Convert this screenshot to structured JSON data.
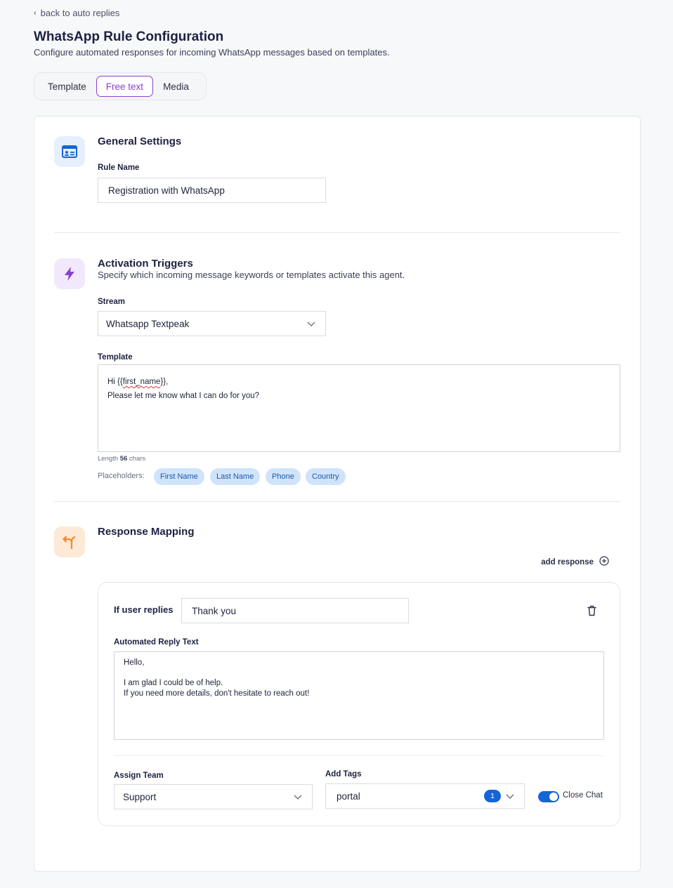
{
  "header": {
    "back_label": "back to auto replies",
    "title": "WhatsApp Rule Configuration",
    "subtitle": "Configure automated responses for incoming WhatsApp messages based on templates."
  },
  "tabs": [
    {
      "label": "Template",
      "active": false
    },
    {
      "label": "Free text",
      "active": true
    },
    {
      "label": "Media",
      "active": false
    }
  ],
  "general": {
    "title": "General Settings",
    "rule_name_label": "Rule Name",
    "rule_name_value": "Registration with WhatsApp"
  },
  "triggers": {
    "title": "Activation Triggers",
    "description": "Specify which incoming message keywords or templates activate this agent.",
    "stream_label": "Stream",
    "stream_value": "Whatsapp Textpeak",
    "template_label": "Template",
    "template_line1_prefix": "Hi {{",
    "template_line1_var": "first_name",
    "template_line1_suffix": "}},",
    "template_line2": "Please let me know what I can do for you?",
    "length_prefix": "Length",
    "length_value": "56",
    "length_suffix": "chars",
    "placeholders_label": "Placeholders:",
    "placeholders": [
      "First Name",
      "Last Name",
      "Phone",
      "Country"
    ]
  },
  "mapping": {
    "title": "Response Mapping",
    "add_response_label": "add response",
    "if_user_replies_label": "If user replies",
    "if_user_replies_value": "Thank you",
    "reply_text_label": "Automated Reply Text",
    "reply_text_value": "Hello,\n\nI am glad I could be of help.\nIf you need more details, don't hesitate to reach out!",
    "assign_team_label": "Assign Team",
    "assign_team_value": "Support",
    "add_tags_label": "Add Tags",
    "add_tags_value": "portal",
    "tags_count": "1",
    "close_chat_label": "Close Chat",
    "close_chat_on": true
  },
  "colors": {
    "accent_purple": "#8a3fd1",
    "toggle_blue": "#1565d8",
    "chip_bg": "#cfe3fb"
  }
}
